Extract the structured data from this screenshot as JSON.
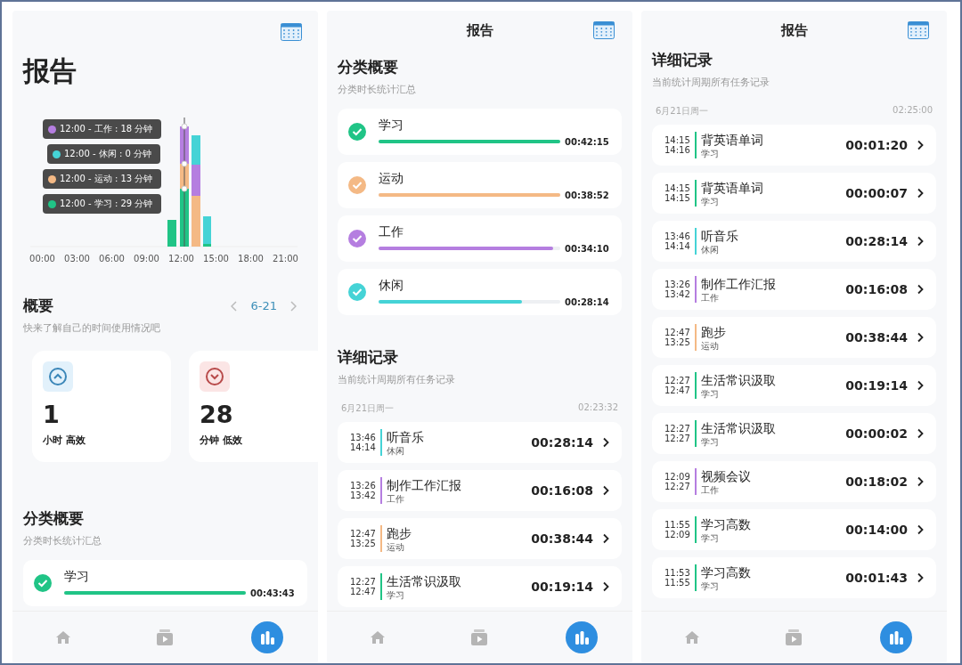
{
  "screens": [
    {
      "kind": "overview",
      "title": "报告",
      "chart": {
        "tooltips": [
          {
            "text": "12:00 - 工作 : 18 分钟",
            "color": "#b57ee0"
          },
          {
            "text": "12:00 - 休闲 : 0 分钟",
            "color": "#45d3d6"
          },
          {
            "text": "12:00 - 运动 : 13 分钟",
            "color": "#f4b985"
          },
          {
            "text": "12:00 - 学习 : 29 分钟",
            "color": "#20c486"
          }
        ],
        "axis_labels": [
          "00:00",
          "03:00",
          "06:00",
          "09:00",
          "12:00",
          "15:00",
          "18:00",
          "21:00"
        ]
      },
      "summary": {
        "heading": "概要",
        "subtitle": "快来了解自己的时间使用情况吧",
        "date": "6-21",
        "cards": [
          {
            "kind": "up",
            "value": "1",
            "label": "小时 高效"
          },
          {
            "kind": "down",
            "value": "28",
            "label": "分钟 低效"
          }
        ]
      },
      "categories": {
        "heading": "分类概要",
        "subtitle": "分类时长统计汇总",
        "items": [
          {
            "name": "学习",
            "color": "#20c486",
            "level": 1,
            "duration": "00:43:43"
          }
        ]
      },
      "nav": [
        {
          "kind": "home",
          "selected": false
        },
        {
          "kind": "video",
          "selected": false
        },
        {
          "kind": "stats",
          "selected": true
        }
      ]
    },
    {
      "kind": "detail",
      "title": "报告",
      "categories": {
        "heading": "分类概要",
        "subtitle": "分类时长统计汇总",
        "items": [
          {
            "name": "学习",
            "color": "#20c486",
            "level": 1,
            "duration": "00:42:15"
          },
          {
            "name": "运动",
            "color": "#f4b985",
            "level": 1,
            "duration": "00:38:52"
          },
          {
            "name": "工作",
            "color": "#b57ee0",
            "level": 0.96,
            "duration": "00:34:10"
          },
          {
            "name": "休闲",
            "color": "#45d3d6",
            "level": 0.79,
            "duration": "00:28:14"
          }
        ]
      },
      "records": {
        "heading": "详细记录",
        "subtitle": "当前统计周期所有任务记录",
        "date": "6月21日周一",
        "total": "02:23:32",
        "items": [
          {
            "start": "13:46",
            "end": "14:14",
            "title": "听音乐",
            "category": "休闲",
            "color": "#45d3d6",
            "duration": "00:28:14"
          },
          {
            "start": "13:26",
            "end": "13:42",
            "title": "制作工作汇报",
            "category": "工作",
            "color": "#b57ee0",
            "duration": "00:16:08"
          },
          {
            "start": "12:47",
            "end": "13:25",
            "title": "跑步",
            "category": "运动",
            "color": "#f4b985",
            "duration": "00:38:44"
          },
          {
            "start": "12:27",
            "end": "12:47",
            "title": "生活常识汲取",
            "category": "学习",
            "color": "#20c486",
            "duration": "00:19:14"
          }
        ]
      },
      "nav": [
        {
          "kind": "home",
          "selected": false
        },
        {
          "kind": "video",
          "selected": false
        },
        {
          "kind": "stats",
          "selected": true
        }
      ]
    },
    {
      "kind": "detail",
      "title": "报告",
      "records": {
        "heading": "详细记录",
        "subtitle": "当前统计周期所有任务记录",
        "date": "6月21日周一",
        "total": "02:25:00",
        "items": [
          {
            "start": "14:15",
            "end": "14:16",
            "title": "背英语单词",
            "category": "学习",
            "color": "#20c486",
            "duration": "00:01:20"
          },
          {
            "start": "14:15",
            "end": "14:15",
            "title": "背英语单词",
            "category": "学习",
            "color": "#20c486",
            "duration": "00:00:07"
          },
          {
            "start": "13:46",
            "end": "14:14",
            "title": "听音乐",
            "category": "休闲",
            "color": "#45d3d6",
            "duration": "00:28:14"
          },
          {
            "start": "13:26",
            "end": "13:42",
            "title": "制作工作汇报",
            "category": "工作",
            "color": "#b57ee0",
            "duration": "00:16:08"
          },
          {
            "start": "12:47",
            "end": "13:25",
            "title": "跑步",
            "category": "运动",
            "color": "#f4b985",
            "duration": "00:38:44"
          },
          {
            "start": "12:27",
            "end": "12:47",
            "title": "生活常识汲取",
            "category": "学习",
            "color": "#20c486",
            "duration": "00:19:14"
          },
          {
            "start": "12:27",
            "end": "12:27",
            "title": "生活常识汲取",
            "category": "学习",
            "color": "#20c486",
            "duration": "00:00:02"
          },
          {
            "start": "12:09",
            "end": "12:27",
            "title": "视频会议",
            "category": "工作",
            "color": "#b57ee0",
            "duration": "00:18:02"
          },
          {
            "start": "11:55",
            "end": "12:09",
            "title": "学习高数",
            "category": "学习",
            "color": "#20c486",
            "duration": "00:14:00"
          },
          {
            "start": "11:53",
            "end": "11:55",
            "title": "学习高数",
            "category": "学习",
            "color": "#20c486",
            "duration": "00:01:43"
          }
        ]
      },
      "nav": [
        {
          "kind": "home",
          "selected": false
        },
        {
          "kind": "video",
          "selected": false
        },
        {
          "kind": "stats",
          "selected": true
        }
      ]
    }
  ]
}
